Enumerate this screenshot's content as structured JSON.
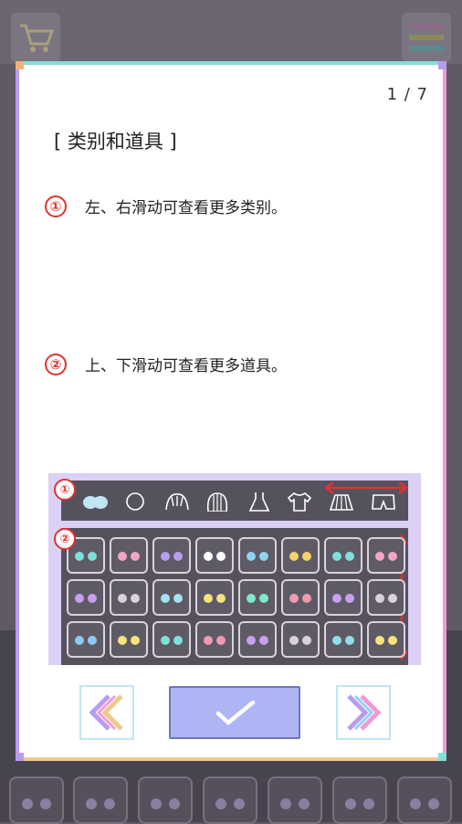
{
  "dialog": {
    "page_counter": "1 / 7",
    "section_title": "[ 类别和道具 ]",
    "steps": [
      {
        "number": "①",
        "text": "左、右滑动可查看更多类别。"
      },
      {
        "number": "②",
        "text": "上、下滑动可查看更多道具。"
      }
    ],
    "illustration": {
      "badges": [
        "①",
        "②"
      ],
      "categories": [
        "face-icon",
        "head-icon",
        "hair-front-icon",
        "hair-back-icon",
        "dress-icon",
        "shirt-icon",
        "skirt-icon",
        "shorts-icon"
      ],
      "eye_colors": [
        "#7fe0d8",
        "#f3a5c6",
        "#b79cf0",
        "#ffffff",
        "#8fd3f5",
        "#f6d36a",
        "#7fe0d8",
        "#f3a5c6",
        "#c9a0f0",
        "#d8d3dc",
        "#a3e2f5",
        "#f6e37a",
        "#7fe8c8",
        "#f39ab0",
        "#c9a0f0",
        "#d8d3dc",
        "#8fc8f5",
        "#f6e37a",
        "#7fe0d8",
        "#f39ab0",
        "#c9a0f0",
        "#d8d3dc",
        "#8fe0e8",
        "#f6e37a"
      ]
    },
    "buttons": {
      "prev_icon": "double-chevron-left-icon",
      "confirm_icon": "checkmark-icon",
      "next_icon": "double-chevron-right-icon"
    }
  },
  "background": {
    "cart_icon": "shopping-cart-icon",
    "menu_icon": "menu-icon"
  }
}
